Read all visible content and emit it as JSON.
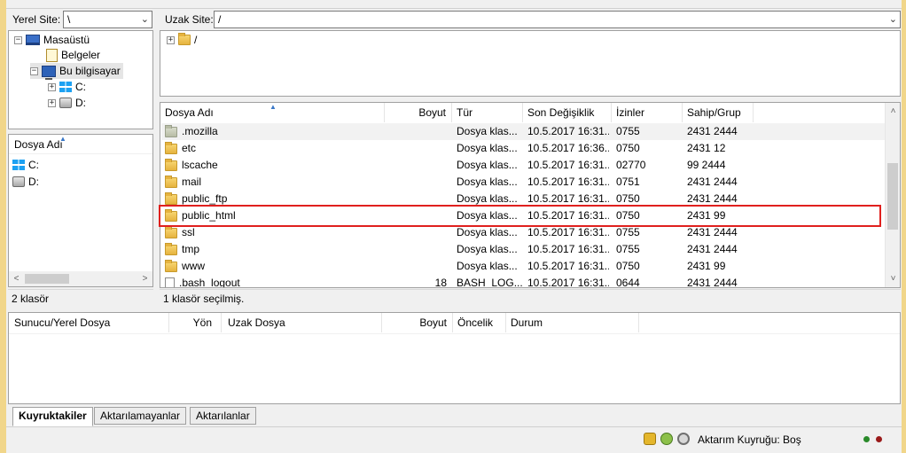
{
  "local": {
    "site_label": "Yerel Site:",
    "site_value": "\\",
    "tree": [
      {
        "label": "Masaüstü",
        "icon": "monitor-icon"
      },
      {
        "label": "Belgeler",
        "icon": "document-icon"
      },
      {
        "label": "Bu bilgisayar",
        "icon": "computer-icon"
      },
      {
        "label": "C:",
        "icon": "windows-drive-icon"
      },
      {
        "label": "D:",
        "icon": "drive-icon"
      }
    ],
    "list_header": "Dosya Adı",
    "files": [
      {
        "name": "C:",
        "icon": "windows-drive-icon"
      },
      {
        "name": "D:",
        "icon": "drive-icon"
      }
    ],
    "status": "2 klasör"
  },
  "remote": {
    "site_label": "Uzak Site:",
    "site_value": "/",
    "tree_root": "/",
    "columns": [
      "Dosya Adı",
      "Boyut",
      "Tür",
      "Son Değişiklik",
      "İzinler",
      "Sahip/Grup"
    ],
    "rows": [
      {
        "name": ".mozilla",
        "size": "",
        "type": "Dosya klas...",
        "modified": "10.5.2017 16:31...",
        "perms": "0755",
        "owner": "2431 2444",
        "icon": "folder-grey-icon"
      },
      {
        "name": "etc",
        "size": "",
        "type": "Dosya klas...",
        "modified": "10.5.2017 16:36...",
        "perms": "0750",
        "owner": "2431 12",
        "icon": "folder-icon"
      },
      {
        "name": "lscache",
        "size": "",
        "type": "Dosya klas...",
        "modified": "10.5.2017 16:31...",
        "perms": "02770",
        "owner": "99 2444",
        "icon": "folder-icon"
      },
      {
        "name": "mail",
        "size": "",
        "type": "Dosya klas...",
        "modified": "10.5.2017 16:31...",
        "perms": "0751",
        "owner": "2431 2444",
        "icon": "folder-icon"
      },
      {
        "name": "public_ftp",
        "size": "",
        "type": "Dosya klas...",
        "modified": "10.5.2017 16:31...",
        "perms": "0750",
        "owner": "2431 2444",
        "icon": "folder-icon"
      },
      {
        "name": "public_html",
        "size": "",
        "type": "Dosya klas...",
        "modified": "10.5.2017 16:31...",
        "perms": "0750",
        "owner": "2431 99",
        "icon": "folder-icon"
      },
      {
        "name": "ssl",
        "size": "",
        "type": "Dosya klas...",
        "modified": "10.5.2017 16:31...",
        "perms": "0755",
        "owner": "2431 2444",
        "icon": "folder-icon"
      },
      {
        "name": "tmp",
        "size": "",
        "type": "Dosya klas...",
        "modified": "10.5.2017 16:31...",
        "perms": "0755",
        "owner": "2431 2444",
        "icon": "folder-icon"
      },
      {
        "name": "www",
        "size": "",
        "type": "Dosya klas...",
        "modified": "10.5.2017 16:31...",
        "perms": "0750",
        "owner": "2431 99",
        "icon": "folder-icon"
      },
      {
        "name": ".bash_logout",
        "size": "18",
        "type": "BASH_LOG...",
        "modified": "10.5.2017 16:31...",
        "perms": "0644",
        "owner": "2431 2444",
        "icon": "file-icon"
      }
    ],
    "status": "1 klasör seçilmiş."
  },
  "queue": {
    "columns": [
      "Sunucu/Yerel Dosya",
      "Yön",
      "Uzak Dosya",
      "Boyut",
      "Öncelik",
      "Durum"
    ],
    "tabs": [
      "Kuyruktakiler",
      "Aktarılamayanlar",
      "Aktarılanlar"
    ],
    "status": "Aktarım Kuyruğu: Boş"
  },
  "colors": {
    "highlight": "#e0201e",
    "frame": "#f1d68a"
  }
}
